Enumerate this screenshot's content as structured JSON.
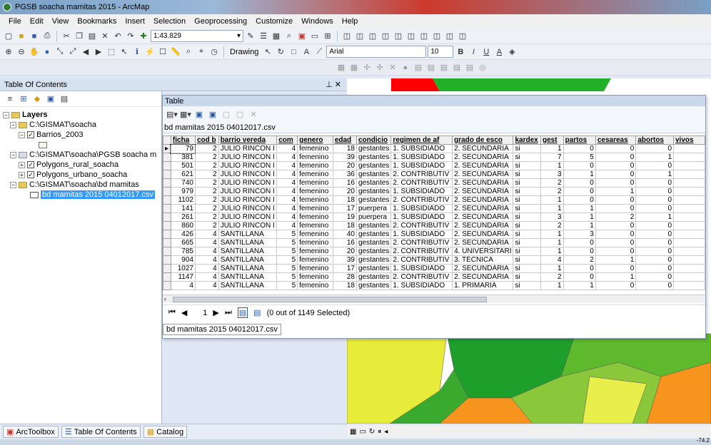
{
  "window": {
    "title": "PGSB soacha mamitas 2015 - ArcMap"
  },
  "menu": [
    "File",
    "Edit",
    "View",
    "Bookmarks",
    "Insert",
    "Selection",
    "Geoprocessing",
    "Customize",
    "Windows",
    "Help"
  ],
  "toolbar": {
    "scale": "1:43.829",
    "drawing_label": "Drawing",
    "font_name": "Arial",
    "font_size": "10",
    "bold": "B",
    "italic": "I",
    "underline": "U",
    "text_tool": "A"
  },
  "toc": {
    "title": "Table Of Contents",
    "root": "Layers",
    "items": [
      {
        "level": 1,
        "type": "folder",
        "label": "C:\\GISMAT\\soacha"
      },
      {
        "level": 2,
        "type": "layer",
        "label": "Barrios_2003",
        "checked": true
      },
      {
        "level": 1,
        "type": "folder",
        "label": "C:\\GISMAT\\soacha\\PGSB soacha m"
      },
      {
        "level": 2,
        "type": "layer",
        "label": "Polygons_rural_soacha",
        "checked": true
      },
      {
        "level": 2,
        "type": "layer",
        "label": "Polygons_urbano_soacha",
        "checked": true
      },
      {
        "level": 1,
        "type": "folder",
        "label": "C:\\GISMAT\\soacha\\bd mamitas"
      },
      {
        "level": 2,
        "type": "table",
        "label": "bd mamitas 2015 04012017.csv",
        "selected": true
      }
    ]
  },
  "bottom_tabs": [
    "ArcToolbox",
    "Table Of Contents",
    "Catalog"
  ],
  "table": {
    "window_title": "Table",
    "name": "bd mamitas 2015 04012017.csv",
    "columns": [
      "ficha",
      "cod b",
      "barrio vereda",
      "com",
      "genero",
      "edad",
      "condicio",
      "regimen de af",
      "grado de esco",
      "kardex",
      "gest",
      "partos",
      "cesareas",
      "abortos",
      "vivos"
    ],
    "rows": [
      [
        "79",
        "2",
        "JULIO RINCON I",
        "4",
        "femenino",
        "18",
        "gestantes",
        "1. SUBSIDIADO",
        "2. SECUNDARIA",
        "si",
        "1",
        "0",
        "0",
        "0",
        ""
      ],
      [
        "381",
        "2",
        "JULIO RINCON I",
        "4",
        "femenino",
        "39",
        "gestantes",
        "1. SUBSIDIADO",
        "2. SECUNDARIA",
        "si",
        "7",
        "5",
        "0",
        "1",
        ""
      ],
      [
        "501",
        "2",
        "JULIO RINCON I",
        "4",
        "femenino",
        "20",
        "gestantes",
        "1. SUBSIDIADO",
        "2. SECUNDARIA",
        "si",
        "1",
        "0",
        "0",
        "0",
        ""
      ],
      [
        "621",
        "2",
        "JULIO RINCON I",
        "4",
        "femenino",
        "36",
        "gestantes",
        "2. CONTRIBUTIV",
        "2. SECUNDARIA",
        "si",
        "3",
        "1",
        "0",
        "1",
        ""
      ],
      [
        "740",
        "2",
        "JULIO RINCON I",
        "4",
        "femenino",
        "16",
        "gestantes",
        "2. CONTRIBUTIV",
        "2. SECUNDARIA",
        "si",
        "2",
        "0",
        "0",
        "0",
        ""
      ],
      [
        "979",
        "2",
        "JULIO RINCON I",
        "4",
        "femenino",
        "20",
        "gestantes",
        "1. SUBSIDIADO",
        "2. SECUNDARIA",
        "si",
        "2",
        "0",
        "1",
        "0",
        ""
      ],
      [
        "1102",
        "2",
        "JULIO RINCON I",
        "4",
        "femenino",
        "18",
        "gestantes",
        "2. CONTRIBUTIV",
        "2. SECUNDARIA",
        "si",
        "1",
        "0",
        "0",
        "0",
        ""
      ],
      [
        "141",
        "2",
        "JULIO RINCON I",
        "4",
        "femenino",
        "17",
        "puerpera",
        "1. SUBSIDIADO",
        "2. SECUNDARIA",
        "si",
        "1",
        "1",
        "0",
        "0",
        ""
      ],
      [
        "261",
        "2",
        "JULIO RINCON I",
        "4",
        "femenino",
        "19",
        "puerpera",
        "1. SUBSIDIADO",
        "2. SECUNDARIA",
        "si",
        "3",
        "1",
        "2",
        "1",
        ""
      ],
      [
        "860",
        "2",
        "JULIO RINCON I",
        "4",
        "femenino",
        "18",
        "gestantes",
        "2. CONTRIBUTIV",
        "2. SECUNDARIA",
        "si",
        "2",
        "1",
        "0",
        "0",
        ""
      ],
      [
        "426",
        "4",
        "SANTILLANA",
        "5",
        "femenino",
        "40",
        "gestantes",
        "1. SUBSIDIADO",
        "2. SECUNDARIA",
        "si",
        "1",
        "3",
        "0",
        "0",
        ""
      ],
      [
        "665",
        "4",
        "SANTILLANA",
        "5",
        "femenino",
        "16",
        "gestantes",
        "2. CONTRIBUTIV",
        "2. SECUNDARIA",
        "si",
        "1",
        "0",
        "0",
        "0",
        ""
      ],
      [
        "785",
        "4",
        "SANTILLANA",
        "5",
        "femenino",
        "20",
        "gestantes",
        "2. CONTRIBUTIV",
        "4. UNIVERSITARI",
        "si",
        "1",
        "0",
        "0",
        "0",
        ""
      ],
      [
        "904",
        "4",
        "SANTILLANA",
        "5",
        "femenino",
        "39",
        "gestantes",
        "2. CONTRIBUTIV",
        "3. TÉCNICA",
        "si",
        "4",
        "2",
        "1",
        "0",
        ""
      ],
      [
        "1027",
        "4",
        "SANTILLANA",
        "5",
        "femenino",
        "17",
        "gestantes",
        "1. SUBSIDIADO",
        "2. SECUNDARIA",
        "si",
        "1",
        "0",
        "0",
        "0",
        ""
      ],
      [
        "1147",
        "4",
        "SANTILLANA",
        "5",
        "femenino",
        "28",
        "gestantes",
        "2. CONTRIBUTIV",
        "2. SECUNDARIA",
        "si",
        "2",
        "0",
        "1",
        "0",
        ""
      ],
      [
        "4",
        "4",
        "SANTILLANA",
        "5",
        "femenino",
        "18",
        "gestantes",
        "1. SUBSIDIADO",
        "1. PRIMARIA",
        "si",
        "1",
        "1",
        "0",
        "0",
        ""
      ]
    ],
    "nav": {
      "record": "1",
      "selection_status": "(0 out of 1149 Selected)"
    },
    "tab_label": "bd mamitas 2015 04012017.csv"
  },
  "status": {
    "coord": "-74.2"
  }
}
